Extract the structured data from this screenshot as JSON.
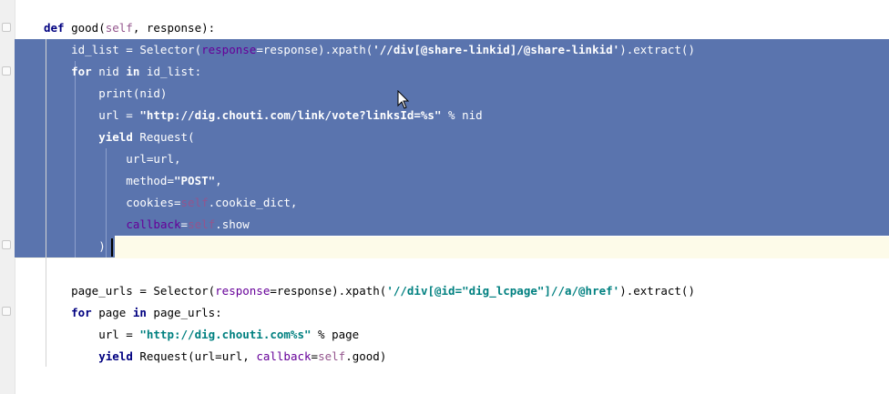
{
  "editor": {
    "language": "python",
    "colors": {
      "selection": "#5a74ae",
      "keyword": "#000080",
      "string": "#008080",
      "self": "#94558d",
      "caret_line": "#fdfbe9"
    },
    "lines": [
      {
        "text": "def good(self, response):"
      },
      {
        "text": "    id_list = Selector(response=response).xpath('//div[@share-linkid]/@share-linkid').extract()"
      },
      {
        "text": "    for nid in id_list:"
      },
      {
        "text": "        print(nid)"
      },
      {
        "text": "        url = \"http://dig.chouti.com/link/vote?linksId=%s\" % nid"
      },
      {
        "text": "        yield Request("
      },
      {
        "text": "            url=url,"
      },
      {
        "text": "            method=\"POST\","
      },
      {
        "text": "            cookies=self.cookie_dict,"
      },
      {
        "text": "            callback=self.show"
      },
      {
        "text": "        )"
      },
      {
        "text": ""
      },
      {
        "text": "    page_urls = Selector(response=response).xpath('//div[@id=\"dig_lcpage\"]//a/@href').extract()"
      },
      {
        "text": "    for page in page_urls:"
      },
      {
        "text": "        url = \"http://dig.chouti.com%s\" % page"
      },
      {
        "text": "        yield Request(url=url, callback=self.good)"
      }
    ]
  }
}
